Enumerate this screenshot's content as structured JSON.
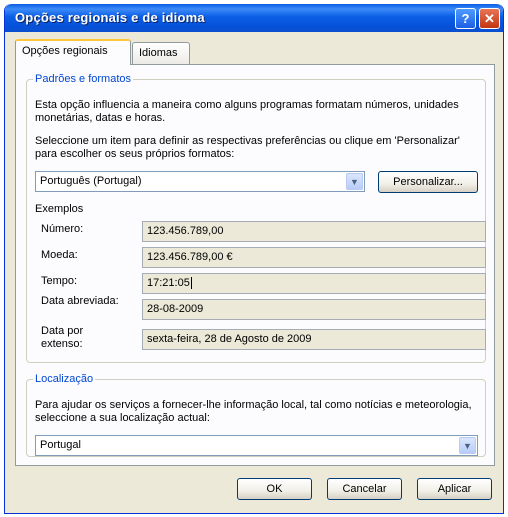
{
  "window": {
    "title": "Opções regionais e de idioma",
    "help_button": "?",
    "close_button": "✕"
  },
  "tabs": [
    {
      "label": "Opções regionais",
      "active": true
    },
    {
      "label": "Idiomas",
      "active": false
    }
  ],
  "standards_group": {
    "title": "Padrões e formatos",
    "description": "Esta opção influencia a maneira como alguns programas formatam números, unidades monetárias, datas e horas.",
    "instruction": "Seleccione um item para definir as respectivas preferências ou clique em 'Personalizar' para escolher os seus próprios formatos:",
    "format_selected": "Português (Portugal)",
    "customize_button": "Personalizar...",
    "examples_heading": "Exemplos",
    "examples": [
      {
        "label": "Número:",
        "value": "123.456.789,00"
      },
      {
        "label": "Moeda:",
        "value": "123.456.789,00 €"
      },
      {
        "label": "Tempo:",
        "value": "17:21:05"
      },
      {
        "label": "Data abreviada:",
        "value": "28-08-2009"
      },
      {
        "label": "Data por extenso:",
        "value": "sexta-feira, 28 de Agosto de 2009"
      }
    ]
  },
  "location_group": {
    "title": "Localização",
    "description": "Para ajudar os serviços a fornecer-lhe informação local, tal como notícias e meteorologia, seleccione a sua localização actual:",
    "location_selected": "Portugal"
  },
  "footer": {
    "ok": "OK",
    "cancel": "Cancelar",
    "apply": "Aplicar"
  },
  "colors": {
    "titlebar": "#0751d9",
    "group_title": "#0046d5",
    "dialog_background": "#ece9d8"
  },
  "icons": [
    "help-icon",
    "close-icon",
    "chevron-down-icon"
  ]
}
